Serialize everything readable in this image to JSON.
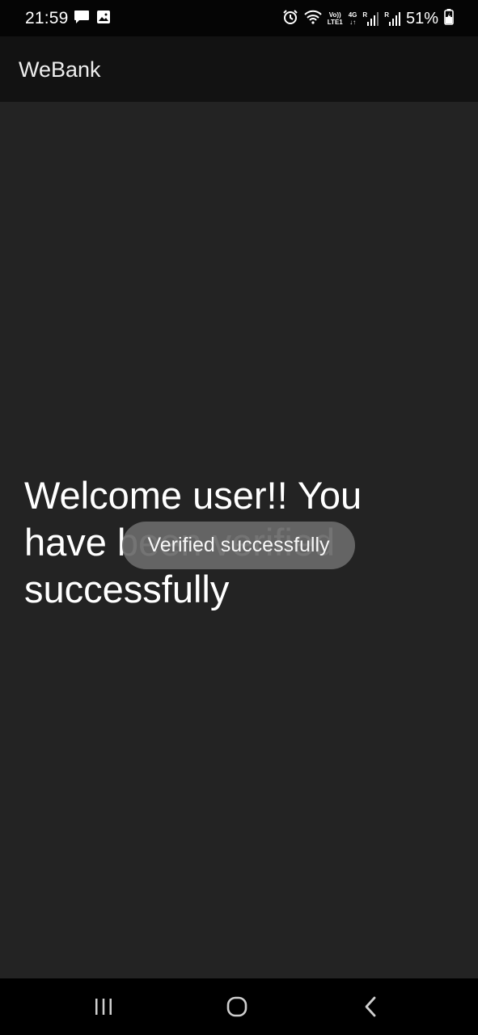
{
  "status_bar": {
    "time": "21:59",
    "network_volte": "Vo))",
    "network_lte": "LTE1",
    "network_4g": "4G",
    "roaming_1": "R",
    "roaming_2": "R",
    "battery": "51%",
    "icons": [
      "message-icon",
      "image-icon",
      "alarm-icon",
      "wifi-icon",
      "signal-icon",
      "battery-icon"
    ]
  },
  "app_bar": {
    "title": "WeBank"
  },
  "main": {
    "message": "Welcome user!! You have been verified successfully"
  },
  "toast": {
    "text": "Verified successfully"
  },
  "nav_bar": {
    "icons": [
      "recents-icon",
      "home-icon",
      "back-icon"
    ]
  },
  "colors": {
    "background": "#232323",
    "app_bar": "#121212",
    "status_bar": "#050505",
    "toast": "#696969",
    "text": "#ffffff"
  }
}
